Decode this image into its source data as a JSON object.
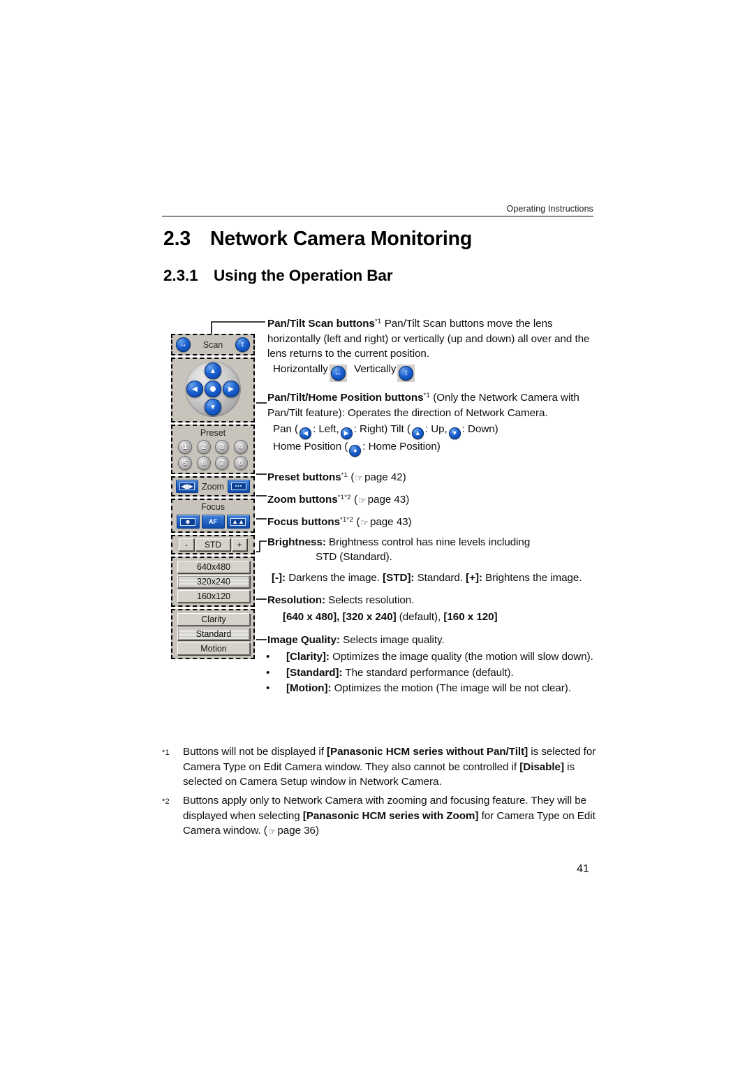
{
  "header": {
    "running_head": "Operating Instructions"
  },
  "titles": {
    "section_number": "2.3",
    "section_title": "Network Camera Monitoring",
    "subsection_number": "2.3.1",
    "subsection_title": "Using the Operation Bar"
  },
  "operation_bar": {
    "scan": {
      "label": "Scan",
      "horizontal_icon": "horizontal-scan-icon",
      "vertical_icon": "vertical-scan-icon"
    },
    "pad": {
      "up_icon": "arrow-up-icon",
      "down_icon": "arrow-down-icon",
      "left_icon": "arrow-left-icon",
      "right_icon": "arrow-right-icon",
      "home_icon": "home-position-icon"
    },
    "preset": {
      "label": "Preset",
      "buttons": [
        "1",
        "2",
        "3",
        "4",
        "5",
        "6",
        "7",
        "8"
      ]
    },
    "zoom": {
      "label": "Zoom",
      "tele_icon": "zoom-tele-icon",
      "wide_icon": "zoom-wide-icon"
    },
    "focus": {
      "label": "Focus",
      "near_icon": "focus-near-icon",
      "auto_label": "AF",
      "far_icon": "focus-far-icon"
    },
    "brightness": {
      "minus_label": "-",
      "std_label": "STD",
      "plus_label": "+"
    },
    "resolution": {
      "options": [
        "640x480",
        "320x240",
        "160x120"
      ],
      "selected": "320x240"
    },
    "image_quality": {
      "options": [
        "Clarity",
        "Standard",
        "Motion"
      ],
      "selected": "Standard"
    }
  },
  "descriptions": {
    "pan_tilt_scan": {
      "term": "Pan/Tilt Scan buttons",
      "footnote": "*1",
      "body": " Pan/Tilt Scan buttons move the lens horizontally (left and right) or vertically (up and down) all over and the lens returns to the current position.",
      "horizontally_label": "Horizontally",
      "vertically_label": "Vertically"
    },
    "pan_tilt_home": {
      "term": "Pan/Tilt/Home Position buttons",
      "footnote": "*1",
      "body": " (Only the Network Camera with Pan/Tilt feature): Operates the direction of Network Camera.",
      "pan_prefix": "Pan (",
      "left_label": ": Left,",
      "right_label": ": Right)",
      "tilt_prefix": "Tilt  (",
      "up_label": ": Up,",
      "down_label": ": Down)",
      "home_prefix": "Home Position (",
      "home_label": ": Home Position)"
    },
    "preset_buttons": {
      "term": "Preset buttons",
      "footnote": "*1",
      "ref_open": "(",
      "ref_text": "page 42)"
    },
    "zoom_buttons": {
      "term": "Zoom buttons",
      "footnote": "*1*2",
      "ref_open": "(",
      "ref_text": "page 43)"
    },
    "focus_buttons": {
      "term": "Focus buttons",
      "footnote": "*1*2",
      "ref_open": "(",
      "ref_text": "page 43)"
    },
    "brightness": {
      "term": "Brightness:",
      "body": " Brightness control has nine levels including",
      "body2": "STD (Standard).",
      "detail_minus": "[-]:",
      "detail_minus_text": " Darkens the image. ",
      "detail_std": "[STD]:",
      "detail_std_text": " Standard. ",
      "detail_plus": "[+]:",
      "detail_plus_text": " Brightens the image."
    },
    "resolution": {
      "term": "Resolution:",
      "body": " Selects resolution.",
      "values_bold_1": "[640 x 480], [320 x 240]",
      "values_plain": " (default), ",
      "values_bold_2": "[160 x 120]"
    },
    "image_quality": {
      "term": "Image Quality:",
      "body": " Selects image quality.",
      "bullets": [
        {
          "bold": "[Clarity]:",
          "text": " Optimizes the image quality (the motion will slow down)."
        },
        {
          "bold": "[Standard]:",
          "text": " The standard performance (default)."
        },
        {
          "bold": "[Motion]:",
          "text": " Optimizes the motion (The image will be not clear)."
        }
      ]
    }
  },
  "footnotes": [
    {
      "mark": "*1",
      "part1": "Buttons will not be displayed if ",
      "bold1": "[Panasonic HCM series without Pan/Tilt]",
      "part2": " is selected for Camera Type on Edit Camera window. They also cannot be controlled if ",
      "bold2": "[Disable]",
      "part3": " is selected on Camera Setup window in Network Camera."
    },
    {
      "mark": "*2",
      "part1": "Buttons apply only to Network Camera with zooming and focusing feature. They will be displayed when selecting ",
      "bold1": "[Panasonic HCM series with Zoom]",
      "part2": " for Camera Type on Edit Camera window. (",
      "ref_text": "page 36)"
    }
  ],
  "page_number": "41"
}
